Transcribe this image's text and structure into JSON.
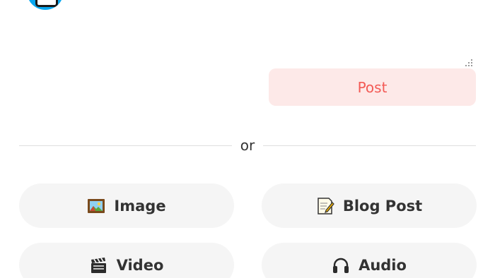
{
  "composer": {
    "post_label": "Post",
    "post_colors": {
      "background": "#fde9e8",
      "text": "#f35a55"
    }
  },
  "divider": {
    "label": "or"
  },
  "options": [
    {
      "label": "Image",
      "icon": "framed-picture-icon"
    },
    {
      "label": "Blog Post",
      "icon": "memo-icon"
    },
    {
      "label": "Video",
      "icon": "clapper-board-icon"
    },
    {
      "label": "Audio",
      "icon": "headphones-icon"
    }
  ],
  "colors": {
    "avatar": "#0aa8f0",
    "option_background": "#f5f5f5",
    "text": "#333333"
  }
}
